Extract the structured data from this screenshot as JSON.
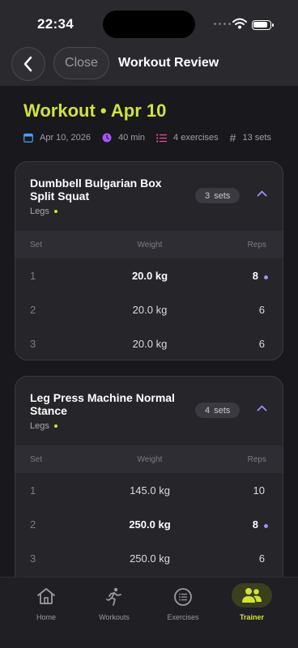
{
  "status": {
    "time": "22:34"
  },
  "nav": {
    "back_label": "",
    "close_label": "Close",
    "title": "Workout Review"
  },
  "workout": {
    "title": "Workout • Apr 10",
    "date": "Apr 10, 2026",
    "duration": "40 min",
    "exercises": "4 exercises",
    "sets": "13 sets"
  },
  "table_headers": {
    "set": "Set",
    "weight": "Weight",
    "reps": "Reps"
  },
  "exercises": [
    {
      "name": "Dumbbell Bulgarian Box Split Squat",
      "muscle": "Legs",
      "sets_count": "3",
      "sets_word": "sets",
      "rows": [
        {
          "set": "1",
          "weight": "20.0 kg",
          "reps": "8",
          "best": true
        },
        {
          "set": "2",
          "weight": "20.0 kg",
          "reps": "6",
          "best": false
        },
        {
          "set": "3",
          "weight": "20.0 kg",
          "reps": "6",
          "best": false
        }
      ]
    },
    {
      "name": "Leg Press Machine Normal Stance",
      "muscle": "Legs",
      "sets_count": "4",
      "sets_word": "sets",
      "rows": [
        {
          "set": "1",
          "weight": "145.0 kg",
          "reps": "10",
          "best": false
        },
        {
          "set": "2",
          "weight": "250.0 kg",
          "reps": "8",
          "best": true
        },
        {
          "set": "3",
          "weight": "250.0 kg",
          "reps": "6",
          "best": false
        }
      ]
    }
  ],
  "tabs": [
    {
      "label": "Home",
      "icon": "home-icon",
      "active": false
    },
    {
      "label": "Workouts",
      "icon": "runner-icon",
      "active": false
    },
    {
      "label": "Exercises",
      "icon": "list-icon",
      "active": false
    },
    {
      "label": "Trainer",
      "icon": "people-icon",
      "active": true
    }
  ],
  "colors": {
    "accent": "#d2e23c",
    "best_dot": "#a78bfa",
    "background": "#18181d",
    "card": "#25252a"
  }
}
